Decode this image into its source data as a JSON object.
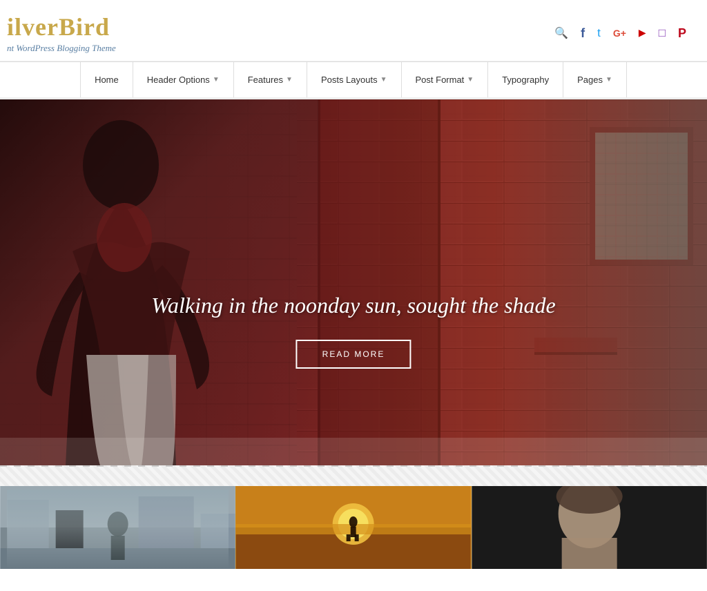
{
  "logo": {
    "title": "ilverBird",
    "subtitle": "nt WordPress Blogging Theme"
  },
  "social": {
    "icons": [
      {
        "name": "search-icon",
        "symbol": "🔍",
        "label": "Search"
      },
      {
        "name": "facebook-icon",
        "symbol": "f",
        "label": "Facebook"
      },
      {
        "name": "twitter-icon",
        "symbol": "t",
        "label": "Twitter"
      },
      {
        "name": "googleplus-icon",
        "symbol": "G+",
        "label": "Google Plus"
      },
      {
        "name": "youtube-icon",
        "symbol": "▶",
        "label": "YouTube"
      },
      {
        "name": "instagram-icon",
        "symbol": "◻",
        "label": "Instagram"
      },
      {
        "name": "pinterest-icon",
        "symbol": "P",
        "label": "Pinterest"
      }
    ]
  },
  "nav": {
    "items": [
      {
        "label": "Home",
        "has_dropdown": false
      },
      {
        "label": "Header Options",
        "has_dropdown": true
      },
      {
        "label": "Features",
        "has_dropdown": true
      },
      {
        "label": "Posts Layouts",
        "has_dropdown": true
      },
      {
        "label": "Post Format",
        "has_dropdown": true
      },
      {
        "label": "Typography",
        "has_dropdown": false
      },
      {
        "label": "Pages",
        "has_dropdown": true
      }
    ]
  },
  "hero": {
    "title": "Walking in the noonday sun, sought the shade",
    "button_label": "READ MORE"
  },
  "cards": [
    {
      "bg_class": "card1"
    },
    {
      "bg_class": "card2"
    },
    {
      "bg_class": "card3"
    }
  ]
}
